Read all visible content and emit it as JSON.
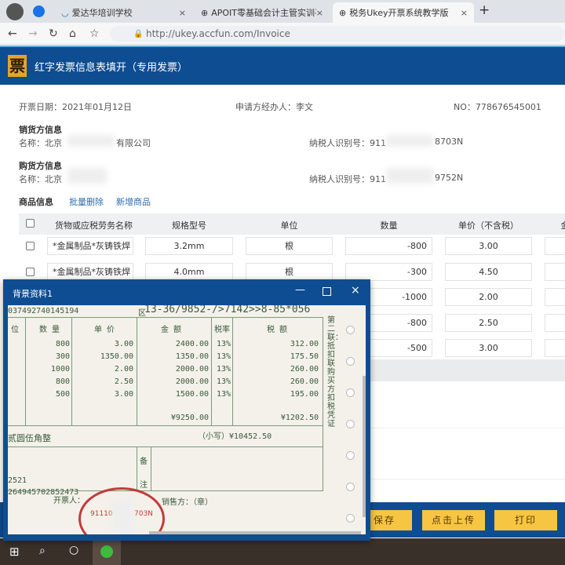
{
  "browser": {
    "tabs": [
      {
        "label": "爱达华培训学校"
      },
      {
        "label": "APOIT零基础会计主管实训平台"
      },
      {
        "label": "税务Ukey开票系统教学版"
      }
    ],
    "url": "http://ukey.accfun.com/Invoice"
  },
  "header": {
    "logo_char": "票",
    "title": "红字发票信息表填开（专用发票）"
  },
  "meta": {
    "date": "开票日期：2021年01月12日",
    "agent": "申请方经办人：李文",
    "no": "NO：778676545001"
  },
  "seller": {
    "title": "销货方信息",
    "name_prefix": "名称：北京",
    "name_suffix": "有限公司",
    "tax_label": "纳税人识别号：911",
    "tax_suffix": "8703N"
  },
  "buyer": {
    "title": "购货方信息",
    "name_prefix": "名称：北京",
    "tax_label": "纳税人识别号：911",
    "tax_suffix": "9752N"
  },
  "goods": {
    "title": "商品信息",
    "batch_delete": "批量删除",
    "add": "新增商品",
    "headers": [
      "货物或应税劳务名称",
      "规格型号",
      "单位",
      "数量",
      "单价（不含税）",
      "金"
    ],
    "rows": [
      {
        "name": "*金属制品*灰铸铁焊",
        "spec": "3.2mm",
        "unit": "根",
        "qty": "-800",
        "price": "3.00"
      },
      {
        "name": "*金属制品*灰铸铁焊",
        "spec": "4.0mm",
        "unit": "根",
        "qty": "-300",
        "price": "4.50"
      },
      {
        "qty": "-1000",
        "price": "2.00"
      },
      {
        "qty": "-800",
        "price": "2.50"
      },
      {
        "qty": "-500",
        "price": "3.00"
      }
    ]
  },
  "buttons": {
    "save": "保存",
    "upload": "点击上传",
    "print": "打印"
  },
  "popup": {
    "title": "背景资料1",
    "code": "0374927401451​94",
    "cipher_label": "区",
    "cipher": "13-36/9852-/>7142>>8-85*056",
    "headers": [
      "位",
      "数 量",
      "单 价",
      "金 额",
      "税率",
      "税 额"
    ],
    "rows": [
      [
        "800",
        "3.00",
        "2400.00",
        "13%",
        "312.00"
      ],
      [
        "300",
        "1350.00",
        "1350.00",
        "13%",
        "175.50"
      ],
      [
        "1000",
        "2.00",
        "2000.00",
        "13%",
        "260.00"
      ],
      [
        "800",
        "2.50",
        "2000.00",
        "13%",
        "260.00"
      ],
      [
        "500",
        "3.00",
        "1500.00",
        "13%",
        "195.00"
      ]
    ],
    "total_amount": "¥9250.00",
    "total_tax": "¥1202.50",
    "total_words": "贰圆伍角整",
    "small_label": "（小写）",
    "total": "¥10452.50",
    "bank1": "2521",
    "bank2": "264945702852473",
    "note1": "备",
    "note2": "注",
    "issuer": "开票人：",
    "seller_seal": "销售方：（章）",
    "side": "第二联：抵扣联 购买方扣税凭证",
    "stamp_text": "91110",
    "stamp_text2": "703N"
  }
}
